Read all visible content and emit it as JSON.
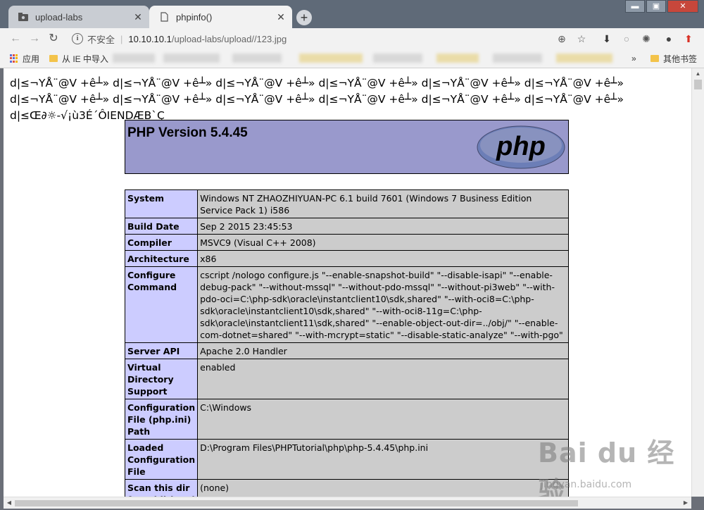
{
  "browser": {
    "tabs": [
      {
        "title": "upload-labs",
        "icon": "folder-icon"
      },
      {
        "title": "phpinfo()",
        "icon": "page-icon"
      }
    ],
    "new_tab_label": "+",
    "address": {
      "security_label": "不安全",
      "separator": "|",
      "host": "10.10.10.1",
      "path": "/upload-labs/upload//123.jpg"
    },
    "bookmarks": {
      "apps_label": "应用",
      "ie_label": "从 IE 中导入",
      "overflow_label": "»",
      "other_label": "其他书签"
    }
  },
  "page": {
    "garbled_lines": [
      "d|≤¬YÅ¨@V +ê┴» d|≤¬YÅ¨@V +ê┴» d|≤¬YÅ¨@V +ê┴» d|≤¬YÅ¨@V +ê┴» d|≤¬YÅ¨@V +ê┴» d|≤¬YÅ¨@V +ê┴»",
      "d|≤¬YÅ¨@V +ê┴» d|≤¬YÅ¨@V +ê┴» d|≤¬YÅ¨@V +ê┴» d|≤¬YÅ¨@V +ê┴» d|≤¬YÅ¨@V +ê┴» d|≤¬YÅ¨@V +ê┴»",
      "d|≤Œ∂☼-√¡ù3É´ÔIENDÆB`Ç"
    ],
    "php_version": "PHP Version 5.4.45",
    "logo_text": "php",
    "rows": [
      {
        "label": "System",
        "value": "Windows NT ZHAOZHIYUAN-PC 6.1 build 7601 (Windows 7 Business Edition Service Pack 1) i586"
      },
      {
        "label": "Build Date",
        "value": "Sep 2 2015 23:45:53"
      },
      {
        "label": "Compiler",
        "value": "MSVC9 (Visual C++ 2008)"
      },
      {
        "label": "Architecture",
        "value": "x86"
      },
      {
        "label": "Configure Command",
        "value": "cscript /nologo configure.js \"--enable-snapshot-build\" \"--disable-isapi\" \"--enable-debug-pack\" \"--without-mssql\" \"--without-pdo-mssql\" \"--without-pi3web\" \"--with-pdo-oci=C:\\php-sdk\\oracle\\instantclient10\\sdk,shared\" \"--with-oci8=C:\\php-sdk\\oracle\\instantclient10\\sdk,shared\" \"--with-oci8-11g=C:\\php-sdk\\oracle\\instantclient11\\sdk,shared\" \"--enable-object-out-dir=../obj/\" \"--enable-com-dotnet=shared\" \"--with-mcrypt=static\" \"--disable-static-analyze\" \"--with-pgo\""
      },
      {
        "label": "Server API",
        "value": "Apache 2.0 Handler"
      },
      {
        "label": "Virtual Directory Support",
        "value": "enabled"
      },
      {
        "label": "Configuration File (php.ini) Path",
        "value": "C:\\Windows"
      },
      {
        "label": "Loaded Configuration File",
        "value": "D:\\Program Files\\PHPTutorial\\php\\php-5.4.45\\php.ini"
      },
      {
        "label": "Scan this dir for additional",
        "value": "(none)"
      }
    ]
  },
  "watermark": {
    "brand": "Bai du 经验",
    "url": "jingyan.baidu.com"
  }
}
